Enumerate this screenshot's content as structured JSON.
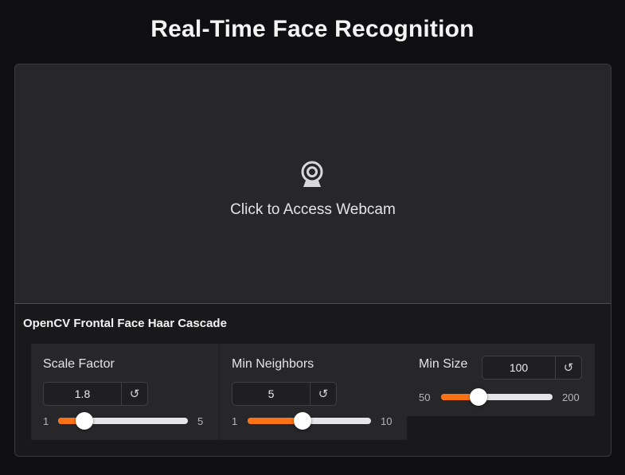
{
  "app": {
    "title": "Real-Time Face Recognition"
  },
  "webcam": {
    "label": "Click to Access Webcam",
    "icon": "webcam-icon"
  },
  "section": {
    "title": "OpenCV Frontal Face Haar Cascade"
  },
  "colors": {
    "accent": "#f97316",
    "panel": "#27272a",
    "background": "#0f0f11"
  },
  "sliders": [
    {
      "label": "Scale Factor",
      "value": "1.8",
      "min": "1",
      "max": "5",
      "fraction": 0.2
    },
    {
      "label": "Min Neighbors",
      "value": "5",
      "min": "1",
      "max": "10",
      "fraction": 0.444
    },
    {
      "label": "Min Size",
      "value": "100",
      "min": "50",
      "max": "200",
      "fraction": 0.333
    }
  ]
}
